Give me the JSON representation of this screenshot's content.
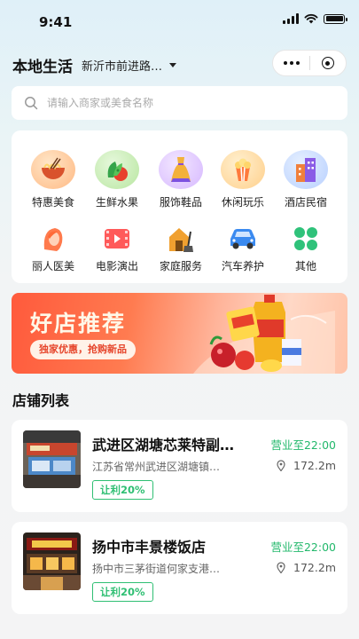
{
  "status_bar": {
    "time": "9:41",
    "icons": [
      "signal-icon",
      "wifi-icon",
      "battery-icon"
    ]
  },
  "header": {
    "title": "本地生活",
    "location": "新沂市前进路…",
    "capsule": {
      "more_icon": "more-dots-icon",
      "close_icon": "target-icon"
    }
  },
  "search": {
    "placeholder": "请输入商家或美食名称",
    "value": "",
    "icon": "search-icon"
  },
  "categories": [
    {
      "label": "特惠美食",
      "icon": "noodle-bowl-icon"
    },
    {
      "label": "生鲜水果",
      "icon": "vegetables-icon"
    },
    {
      "label": "服饰鞋品",
      "icon": "dress-icon"
    },
    {
      "label": "休闲玩乐",
      "icon": "popcorn-icon"
    },
    {
      "label": "酒店民宿",
      "icon": "building-icon"
    },
    {
      "label": "丽人医美",
      "icon": "woman-icon"
    },
    {
      "label": "电影演出",
      "icon": "film-icon"
    },
    {
      "label": "家庭服务",
      "icon": "home-broom-icon"
    },
    {
      "label": "汽车养护",
      "icon": "car-icon"
    },
    {
      "label": "其他",
      "icon": "clover-icon"
    }
  ],
  "banner": {
    "title": "好店推荐",
    "subtitle": "独家优惠，抢购新品"
  },
  "section_title": "店铺列表",
  "shops": [
    {
      "name": "武进区湖塘芯莱特副…",
      "hours": "营业至22:00",
      "address": "江苏省常州武进区湖塘镇…",
      "distance": "172.2m",
      "tag": "让利20%"
    },
    {
      "name": "扬中市丰景楼饭店",
      "hours": "营业至22:00",
      "address": "扬中市三茅街道何家支港…",
      "distance": "172.2m",
      "tag": "让利20%"
    }
  ],
  "colors": {
    "accent_green": "#22b86b",
    "banner_red": "#ff5a3c"
  }
}
